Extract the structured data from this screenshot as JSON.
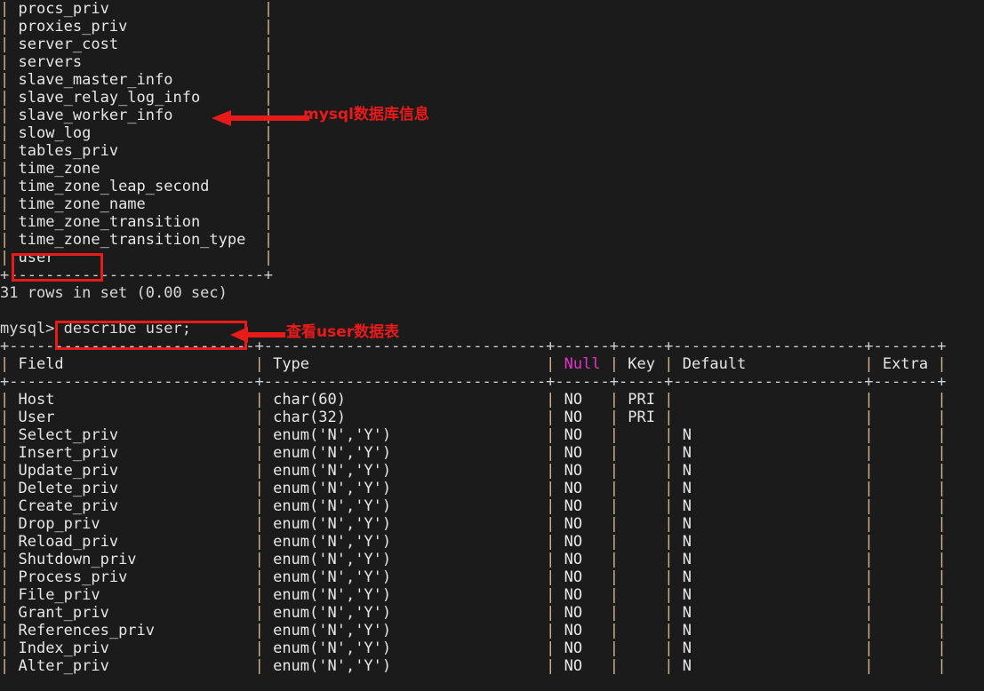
{
  "terminal": {
    "background_color": "#1b1b1b",
    "foreground_color": "#d8d8d8",
    "table_list": {
      "rows": [
        "procs_priv",
        "proxies_priv",
        "server_cost",
        "servers",
        "slave_master_info",
        "slave_relay_log_info",
        "slave_worker_info",
        "slow_log",
        "tables_priv",
        "time_zone",
        "time_zone_leap_second",
        "time_zone_name",
        "time_zone_transition",
        "time_zone_transition_type",
        "user"
      ],
      "bottom_border": "+-----------------------------+",
      "result_status": "31 rows in set (0.00 sec)"
    },
    "prompt": "mysql>",
    "command": "describe user;",
    "describe_table": {
      "top_border": "+---------------------------+-------------------------------+------+-----+---------------------+-------+",
      "header_border": "+---------------------------+-------------------------------+------+-----+---------------------+-------+",
      "columns": [
        "Field",
        "Type",
        "Null",
        "Key",
        "Default",
        "Extra"
      ],
      "null_header_color": "#e432c8",
      "rows": [
        {
          "field": "Host",
          "type": "char(60)",
          "null": "NO",
          "key": "PRI",
          "default": "",
          "extra": ""
        },
        {
          "field": "User",
          "type": "char(32)",
          "null": "NO",
          "key": "PRI",
          "default": "",
          "extra": ""
        },
        {
          "field": "Select_priv",
          "type": "enum('N','Y')",
          "null": "NO",
          "key": "",
          "default": "N",
          "extra": ""
        },
        {
          "field": "Insert_priv",
          "type": "enum('N','Y')",
          "null": "NO",
          "key": "",
          "default": "N",
          "extra": ""
        },
        {
          "field": "Update_priv",
          "type": "enum('N','Y')",
          "null": "NO",
          "key": "",
          "default": "N",
          "extra": ""
        },
        {
          "field": "Delete_priv",
          "type": "enum('N','Y')",
          "null": "NO",
          "key": "",
          "default": "N",
          "extra": ""
        },
        {
          "field": "Create_priv",
          "type": "enum('N','Y')",
          "null": "NO",
          "key": "",
          "default": "N",
          "extra": ""
        },
        {
          "field": "Drop_priv",
          "type": "enum('N','Y')",
          "null": "NO",
          "key": "",
          "default": "N",
          "extra": ""
        },
        {
          "field": "Reload_priv",
          "type": "enum('N','Y')",
          "null": "NO",
          "key": "",
          "default": "N",
          "extra": ""
        },
        {
          "field": "Shutdown_priv",
          "type": "enum('N','Y')",
          "null": "NO",
          "key": "",
          "default": "N",
          "extra": ""
        },
        {
          "field": "Process_priv",
          "type": "enum('N','Y')",
          "null": "NO",
          "key": "",
          "default": "N",
          "extra": ""
        },
        {
          "field": "File_priv",
          "type": "enum('N','Y')",
          "null": "NO",
          "key": "",
          "default": "N",
          "extra": ""
        },
        {
          "field": "Grant_priv",
          "type": "enum('N','Y')",
          "null": "NO",
          "key": "",
          "default": "N",
          "extra": ""
        },
        {
          "field": "References_priv",
          "type": "enum('N','Y')",
          "null": "NO",
          "key": "",
          "default": "N",
          "extra": ""
        },
        {
          "field": "Index_priv",
          "type": "enum('N','Y')",
          "null": "NO",
          "key": "",
          "default": "N",
          "extra": ""
        },
        {
          "field": "Alter_priv",
          "type": "enum('N','Y')",
          "null": "NO",
          "key": "",
          "default": "N",
          "extra": ""
        }
      ]
    }
  },
  "annotations": {
    "color": "#e81b1b",
    "items": [
      {
        "name": "mysql-db-info",
        "label": "mysql数据库信息"
      },
      {
        "name": "view-user-table",
        "label": "查看user数据表"
      }
    ],
    "highlight_boxes": [
      {
        "name": "user-row-highlight",
        "target": "user"
      },
      {
        "name": "describe-command-highlight",
        "target": "describe user;"
      }
    ]
  }
}
